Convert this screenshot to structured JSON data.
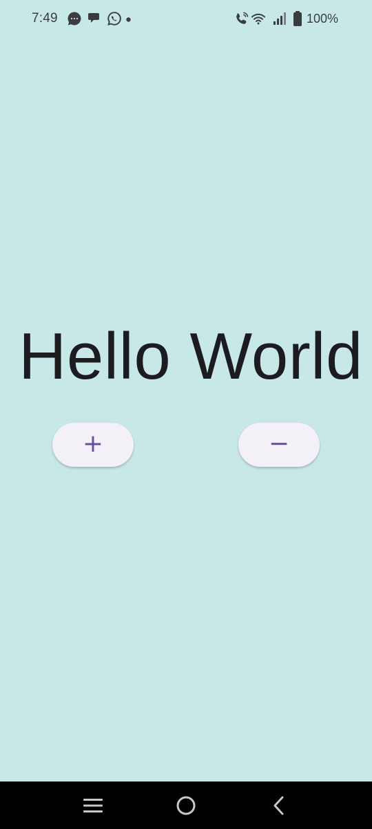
{
  "theme": {
    "background": "#c8e8e7",
    "button_bg": "#f4f0f7",
    "button_fg": "#6750a4",
    "status_fg": "#3a3d3d",
    "nav_bg": "#000000",
    "nav_fg": "#c8c8c8"
  },
  "status_bar": {
    "time": "7:49",
    "left_icons": [
      "messages-icon",
      "chat-bubble-icon",
      "whatsapp-icon",
      "notification-dot-icon"
    ],
    "right_icons": [
      "wifi-calling-icon",
      "wifi-icon",
      "signal-icon",
      "battery-icon"
    ],
    "battery_percent": "100%"
  },
  "main": {
    "greeting": "Hello World",
    "increment_button": {
      "label": "+",
      "icon": "plus"
    },
    "decrement_button": {
      "label": "−",
      "icon": "minus"
    }
  },
  "nav_bar": {
    "buttons": [
      "recent-apps-icon",
      "home-icon",
      "back-icon"
    ]
  }
}
